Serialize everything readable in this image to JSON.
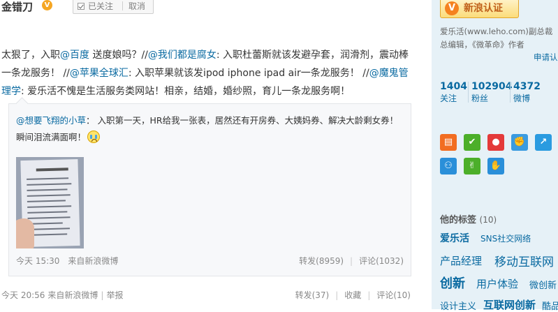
{
  "post": {
    "author": "金错刀",
    "verified_icon": "verified-v-icon",
    "follow_state": "已关注",
    "cancel_label": "取消",
    "text_parts": [
      {
        "t": "太狠了，入职",
        "link": false
      },
      {
        "t": "@百度",
        "link": true
      },
      {
        "t": " 送度娘吗？//",
        "link": false
      },
      {
        "t": "@我们都是腐女",
        "link": true
      },
      {
        "t": ": 入职杜蕾斯就该发避孕套，润滑剂，震动棒一条龙服务！ //",
        "link": false
      },
      {
        "t": "@苹果全球汇",
        "link": true
      },
      {
        "t": ": 入职苹果就该发ipod iphone ipad air一条龙服务！ //",
        "link": false
      },
      {
        "t": "@魔鬼管理学",
        "link": true
      },
      {
        "t": ": 爱乐活不愧是生活服务类网站！相亲，结婚，婚纱照，育儿一条龙服务啊！",
        "link": false
      }
    ],
    "time": "今天 20:56",
    "source": "来自新浪微博",
    "report": "举报",
    "repost": "转发(37)",
    "favorite": "收藏",
    "comment": "评论(10)"
  },
  "retweet": {
    "user": "@想要飞翔的小草",
    "text": "： 入职第一天，HR给我一张表，居然还有开房券、大姨妈券、解决大龄剩女券！瞬间泪流满面啊！",
    "emoji": "crying-face-icon",
    "thumbnail": "photo-of-paper-form",
    "time": "今天 15:30",
    "source": "来自新浪微博",
    "repost": "转发(8959)",
    "comment": "评论(1032)"
  },
  "sidebar": {
    "verify_label": "新浪认证",
    "bio_line1": "爱乐活(www.leho.com)副总裁",
    "bio_line2": "总编辑，《微革命》作者",
    "apply_label": "申请认",
    "stats": [
      {
        "num": "1404",
        "label": "关注"
      },
      {
        "num": "102904",
        "label": "粉丝"
      },
      {
        "num": "4372",
        "label": "微博"
      }
    ],
    "app_icons": [
      {
        "name": "profile-card-icon",
        "color": "#f26d21",
        "glyph": "▤"
      },
      {
        "name": "thumbs-up-icon",
        "color": "#4caf2a",
        "glyph": "✔"
      },
      {
        "name": "microphone-icon",
        "color": "#e43a3a",
        "glyph": "●"
      },
      {
        "name": "fist-icon",
        "color": "#3a9be0",
        "glyph": "✊"
      },
      {
        "name": "share-arrow-icon",
        "color": "#2a9be0",
        "glyph": "↗"
      },
      {
        "name": "partial-icon",
        "color": "#f5a623",
        "glyph": "◐"
      },
      {
        "name": "group-icon",
        "color": "#2a8fd9",
        "glyph": "⚇"
      },
      {
        "name": "hand-clap-icon",
        "color": "#4caf2a",
        "glyph": "✌"
      },
      {
        "name": "palm-icon",
        "color": "#2a8fd9",
        "glyph": "✋"
      }
    ],
    "tags_title": "他的标签",
    "tags_count": "(10)",
    "tags": [
      "爱乐活",
      "SNS社交网络",
      "产品经理",
      "移动互联网",
      "创新",
      "用户体验",
      "微创新",
      "设计主义",
      "互联网创新",
      "酷品"
    ]
  }
}
